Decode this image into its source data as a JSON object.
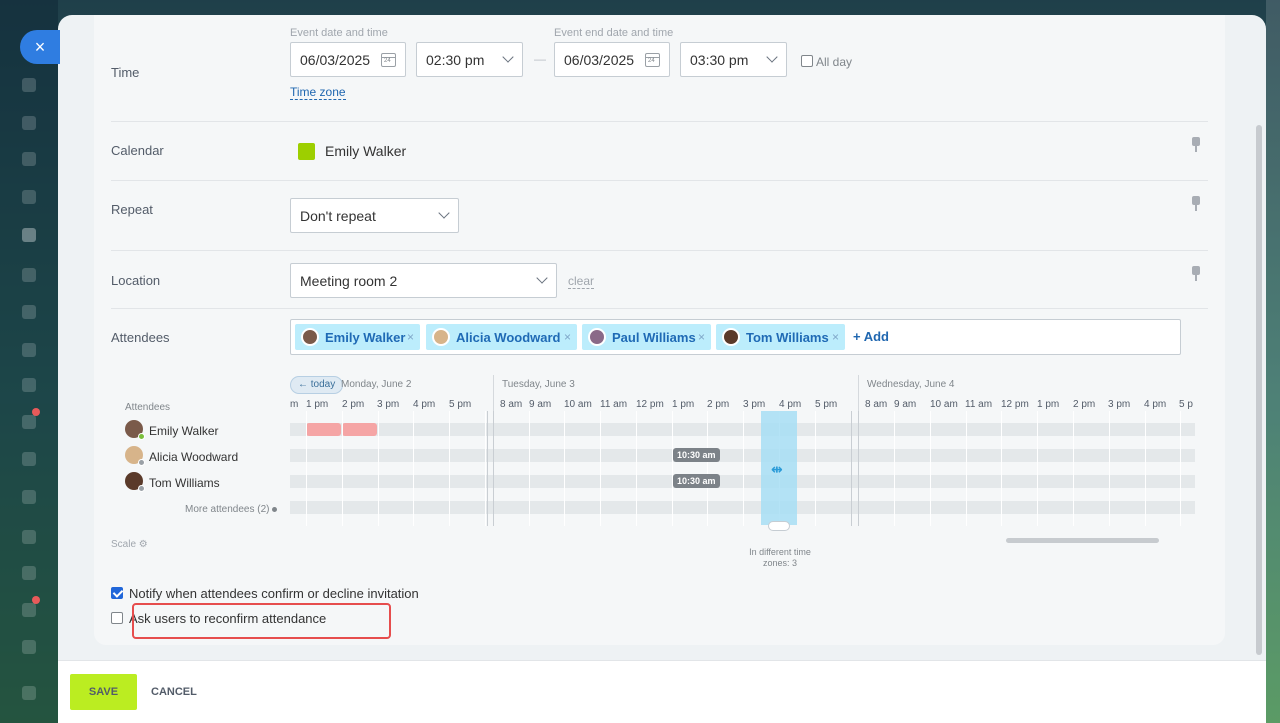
{
  "close_icon": "×",
  "time": {
    "label": "Time",
    "start_caption": "Event date and time",
    "end_caption": "Event end date and time",
    "start_date": "06/03/2025",
    "start_time": "02:30 pm",
    "end_date": "06/03/2025",
    "end_time": "03:30 pm",
    "separator": "—",
    "all_day_label": "All day",
    "all_day_checked": false,
    "time_zone_link": "Time zone",
    "calendar_icon_text": "24"
  },
  "calendar": {
    "label": "Calendar",
    "value": "Emily Walker",
    "color": "#9dcf00"
  },
  "repeat": {
    "label": "Repeat",
    "value": "Don't repeat"
  },
  "location": {
    "label": "Location",
    "value": "Meeting room 2",
    "clear_link": "clear"
  },
  "attendees": {
    "label": "Attendees",
    "tags": [
      {
        "name": "Emily Walker",
        "remove": "×"
      },
      {
        "name": "Alicia Woodward",
        "remove": "×"
      },
      {
        "name": "Paul Williams",
        "remove": "×"
      },
      {
        "name": "Tom Williams",
        "remove": "×"
      }
    ],
    "add_label": "+ Add"
  },
  "planner": {
    "today_label": "← today",
    "days": [
      "Monday, June 2",
      "Tuesday, June 3",
      "Wednesday, June 4"
    ],
    "hours_day1": [
      "m",
      "1 pm",
      "2 pm",
      "3 pm",
      "4 pm",
      "5 pm"
    ],
    "hours_day2": [
      "8 am",
      "9 am",
      "10 am",
      "11 am",
      "12 pm",
      "1 pm",
      "2 pm",
      "3 pm",
      "4 pm",
      "5 pm"
    ],
    "hours_day3": [
      "8 am",
      "9 am",
      "10 am",
      "11 am",
      "12 pm",
      "1 pm",
      "2 pm",
      "3 pm",
      "4 pm",
      "5 p"
    ],
    "attendees_header": "Attendees",
    "people": [
      {
        "name": "Emily Walker",
        "status": "online"
      },
      {
        "name": "Alicia Woodward",
        "status": "away"
      },
      {
        "name": "Tom Williams",
        "status": "away"
      }
    ],
    "more_attendees": "More attendees (2)",
    "time_badges": [
      "10:30 am",
      "10:30 am"
    ],
    "scale_label": "Scale",
    "different_tz_note": "In different time zones: 3",
    "busy_color": "#f5a5a5",
    "selection_color": "#a7def5"
  },
  "options": {
    "notify_label": "Notify when attendees confirm or decline invitation",
    "notify_checked": true,
    "reconfirm_label": "Ask users to reconfirm attendance",
    "reconfirm_checked": false
  },
  "footer": {
    "save": "SAVE",
    "cancel": "CANCEL"
  },
  "colors": {
    "accent": "#2067b0",
    "save_button": "#bbed21",
    "highlight": "#e64d4d"
  }
}
